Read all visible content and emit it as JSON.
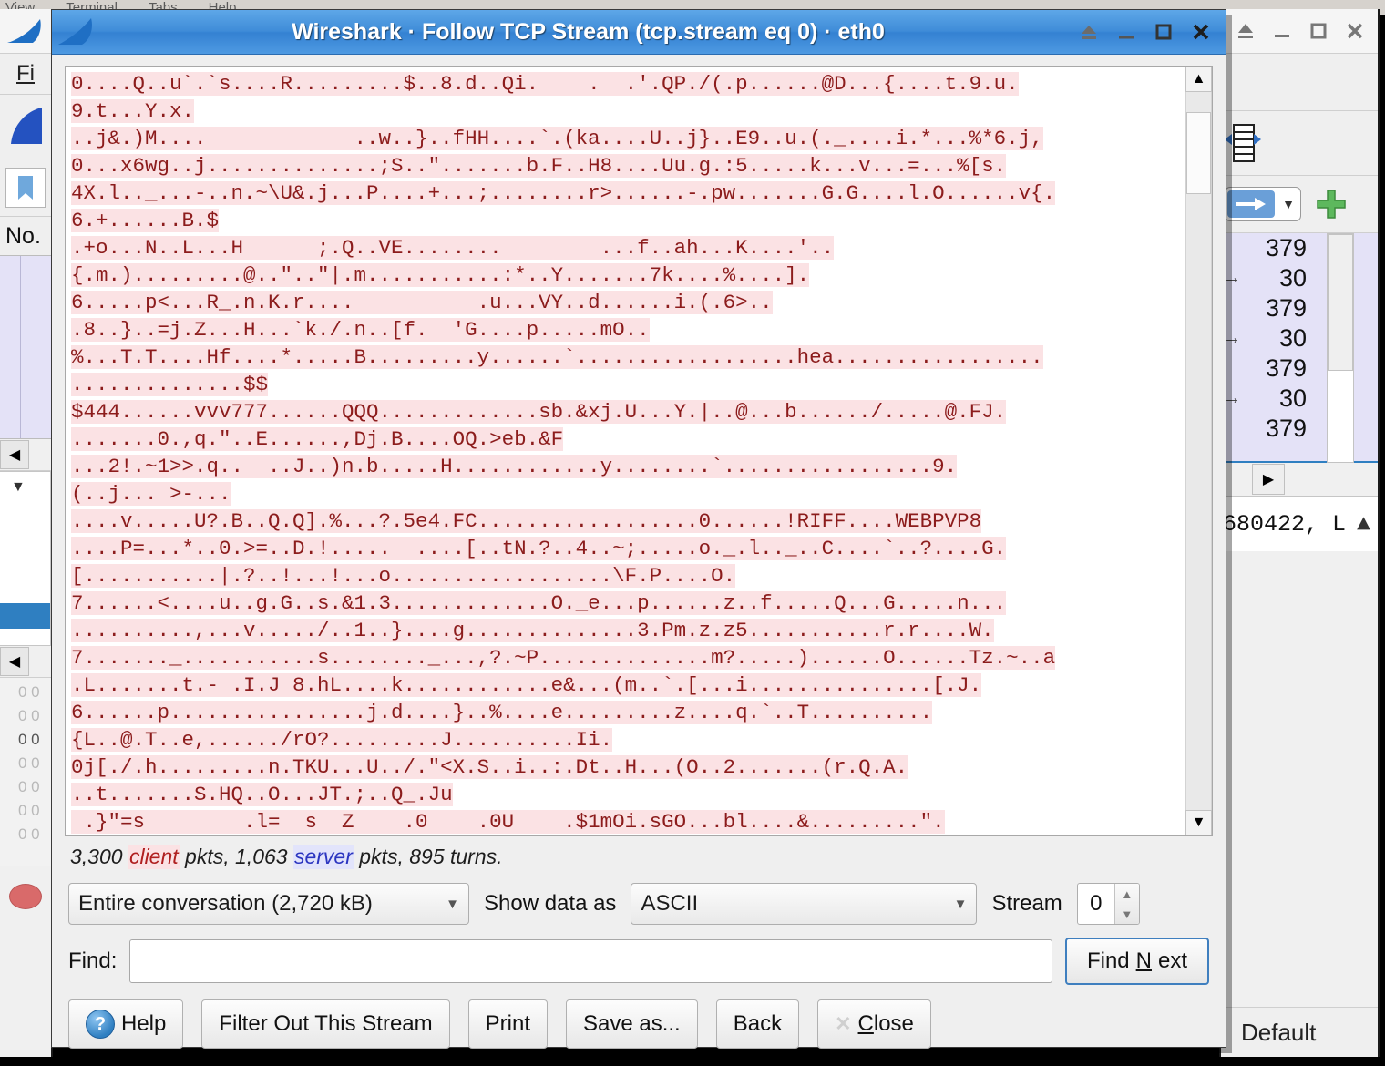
{
  "background": {
    "terminal_menu": [
      "View",
      "Terminal",
      "Tabs",
      "Help"
    ],
    "left_window": {
      "menu_fragment": "Fi",
      "column_header": "No.",
      "icon_shark": "shark-fin-icon",
      "icon_bookmark": "bookmark-icon"
    },
    "right_window": {
      "packet_rows": [
        "379",
        "30",
        "379",
        "30",
        "379",
        "30",
        "379"
      ],
      "detail_text": "680422, L",
      "status_profile": "Default",
      "icons": [
        "columns-icon",
        "blue-arrow-icon",
        "green-plus-icon"
      ]
    }
  },
  "dialog": {
    "title": "Wireshark · Follow TCP Stream (tcp.stream eq 0) · eth0",
    "window_buttons": [
      {
        "name": "shade-button",
        "glyph": "⌂"
      },
      {
        "name": "minimize-button",
        "glyph": "_"
      },
      {
        "name": "maximize-button",
        "glyph": "□"
      },
      {
        "name": "close-button",
        "glyph": "✕"
      }
    ],
    "stream_lines": [
      "0....Q..u`.`s....R.........$..8.d..Qi.    .  .'.QP./(.p......@D...{....t.9.u.",
      "9.t...Y.x.",
      "..j&.)M....            ..w..}..fHH....`.(ka....U..j}..E9..u.(._....i.*...%*6.j,",
      "0...x6wg..j..............;S..\".......b.F..H8....Uu.g.:5.....k...v...=...%[s.",
      "4X.l.._...-..n.~\\U&.j...P....+...;........r>......-.pw.......G.G....l.O......v{.",
      "6.+......B.$",
      ".+o...N..L...H      ;.Q..VE........        ...f..ah...K....'..",
      "{.m.).........@..\"..\"|.m...........:*..Y.......7k....%....].",
      "6.....p<...R_.n.K.r....          .u...VY..d......i.(.6>..",
      ".8..}..=j.Z...H...`k./.n..[f.  'G....p.....mO..",
      "%...T.T....Hf....*.....B.........y......`..................hea.................",
      "..............$$",
      "$444......vvv777......QQQ.............sb.&xj.U...Y.|..@...b....../.....@.FJ.",
      ".......0.,q.\"..E......,Dj.B....OQ.>eb.&F",
      "...2!.~1>>.q..  ..J..)n.b.....H............y........`.................9.",
      "(..j... >-...",
      "....v.....U?.B..Q.Q].%...?.5e4.FC..................0......!RIFF....WEBPVP8",
      "....P=...*..0.>=..D.!.....  ....[..tN.?..4..~;.....o._.l.._..C....`..?....G.",
      "[...........|.?..!...!...o..................\\F.P....O.",
      "7......<....u..g.G..s.&1.3.............O._e...p......z..f.....Q...G.....n...",
      "..........,...v...../..1..}....g..............3.Pm.z.z5...........r.r....W.",
      "7......._...........s........_...,?.~P..............m?.....)......O......Tz.~..a",
      ".L.......t.- .I.J 8.hL....k............e&...(m..`.[...i...............[.J.",
      "6......p................j.d....}..%....e.........z....q.`..T..........",
      "{L..@.T..e,....../rO?.........J..........Ii.",
      "0j[./.h.........n.TKU...U../.\"<X.S..i..:.Dt..H...(O..2.......(r.Q.A.",
      "..t.......S.HQ..O...JT.;..Q_.Ju",
      " .}\"=s        .l=  s  Z    .0    .0U    .$1mOi.sGO...bl....&.........\"."
    ],
    "status": {
      "client_pkts": "3,300",
      "client_word": "client",
      "client_suffix": "pkts,",
      "server_pkts": "1,063",
      "server_word": "server",
      "server_suffix": "pkts,",
      "turns": "895",
      "turns_word": "turns."
    },
    "controls": {
      "conversation_value": "Entire conversation (2,720 kB)",
      "show_data_as_label": "Show data as",
      "show_data_as_value": "ASCII",
      "stream_label": "Stream",
      "stream_value": "0",
      "find_label": "Find:",
      "find_value": "",
      "find_placeholder": "",
      "find_next_pre": "Find ",
      "find_next_mnemonic": "N",
      "find_next_post": "ext"
    },
    "buttons": {
      "help": "Help",
      "filter_out": "Filter Out This Stream",
      "print": "Print",
      "save_as": "Save as...",
      "back": "Back",
      "close_pre": "",
      "close_mnemonic": "C",
      "close_post": "lose"
    }
  },
  "colors": {
    "client_text": "#8c1c1c",
    "client_bg": "#fbe2e4",
    "server_text": "#2b35c0",
    "title_blue": "#3f8cd8",
    "focus_blue": "#3f7fbf"
  }
}
